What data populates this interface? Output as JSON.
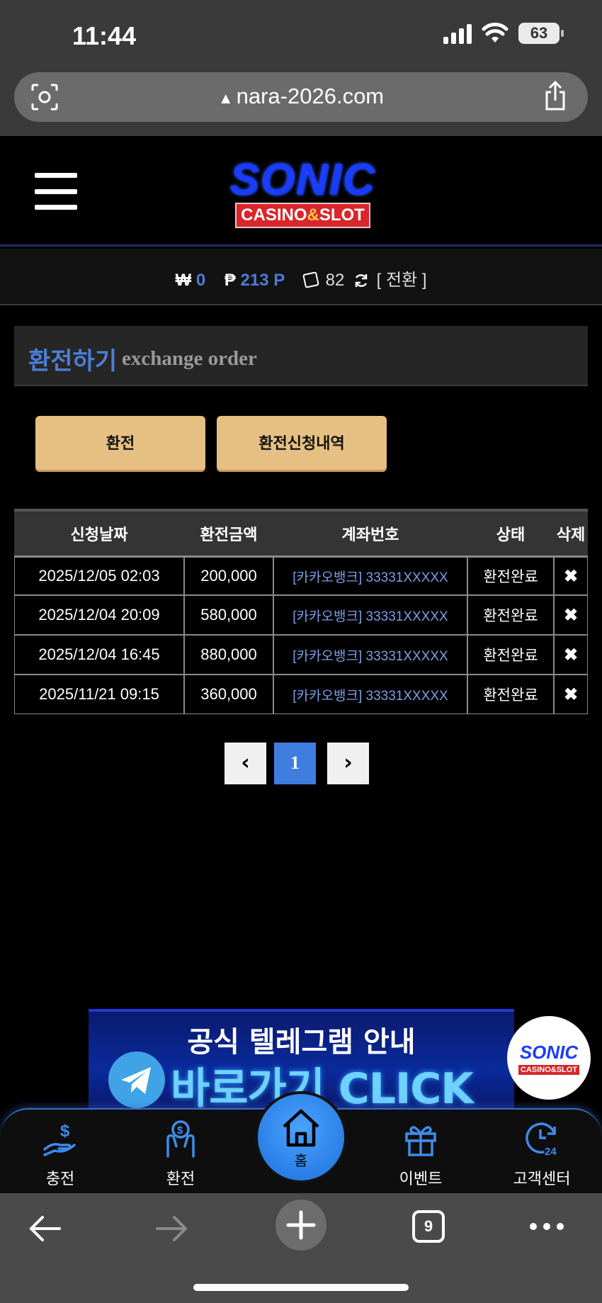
{
  "status_bar": {
    "time": "11:44",
    "battery": "63"
  },
  "browser": {
    "url": "nara-2026.com",
    "tab_count": "9"
  },
  "logo": {
    "top": "SONIC",
    "bottom_left": "CASINO",
    "amp": "&",
    "bottom_right": "SLOT"
  },
  "balance": {
    "won_symbol": "₩",
    "won_value": "0",
    "point_symbol": "₱",
    "point_value": "213 P",
    "chip_value": "82",
    "convert_label": "[ 전환 ]"
  },
  "page": {
    "title_ko": "환전하기",
    "title_en": "exchange order"
  },
  "buttons": {
    "exchange": "환전",
    "history": "환전신청내역"
  },
  "table": {
    "headers": [
      "신청날짜",
      "환전금액",
      "계좌번호",
      "상태",
      "삭제"
    ],
    "rows": [
      {
        "date": "2025/12/05 02:03",
        "amount": "200,000",
        "account": "[카카오뱅크] 33331XXXXX",
        "status": "환전완료",
        "delete": "✖"
      },
      {
        "date": "2025/12/04 20:09",
        "amount": "580,000",
        "account": "[카카오뱅크] 33331XXXXX",
        "status": "환전완료",
        "delete": "✖"
      },
      {
        "date": "2025/12/04 16:45",
        "amount": "880,000",
        "account": "[카카오뱅크] 33331XXXXX",
        "status": "환전완료",
        "delete": "✖"
      },
      {
        "date": "2025/11/21 09:15",
        "amount": "360,000",
        "account": "[카카오뱅크] 33331XXXXX",
        "status": "환전완료",
        "delete": "✖"
      }
    ]
  },
  "pagination": {
    "prev": "‹",
    "current": "1",
    "next": "›"
  },
  "banner": {
    "top_text": "공식 텔레그램 안내",
    "main_text": "바로가기 CLICK"
  },
  "floating_logo": {
    "top": "SONIC",
    "bottom": "CASINO&SLOT"
  },
  "bottom_nav": {
    "deposit": "충전",
    "exchange": "환전",
    "home": "홈",
    "event": "이벤트",
    "support": "고객센터"
  },
  "colors": {
    "accent_blue": "#4a7fd9",
    "button_gold": "#e6bf82",
    "nav_blue": "#3f8bea"
  }
}
